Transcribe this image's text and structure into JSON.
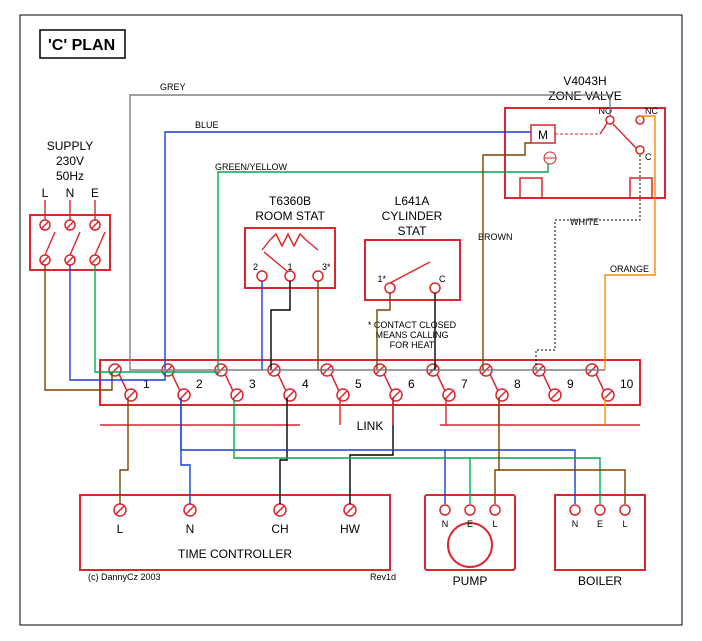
{
  "title": "'C' PLAN",
  "supply": {
    "label": "SUPPLY",
    "voltage": "230V",
    "freq": "50Hz",
    "L": "L",
    "N": "N",
    "E": "E"
  },
  "zone_valve": {
    "model": "V4043H",
    "label": "ZONE VALVE",
    "M": "M",
    "NO": "NO",
    "NC": "NC",
    "C": "C"
  },
  "room_stat": {
    "model": "T6360B",
    "label": "ROOM STAT",
    "t1": "1",
    "t2": "2",
    "t3": "3*"
  },
  "cyl_stat": {
    "model": "L641A",
    "label": "CYLINDER",
    "label2": "STAT",
    "t1": "1*",
    "tC": "C",
    "note1": "* CONTACT CLOSED",
    "note2": "MEANS CALLING",
    "note3": "FOR HEAT"
  },
  "junction": {
    "nums": [
      "1",
      "2",
      "3",
      "4",
      "5",
      "6",
      "7",
      "8",
      "9",
      "10"
    ],
    "link": "LINK"
  },
  "time_controller": {
    "label": "TIME CONTROLLER",
    "L": "L",
    "N": "N",
    "CH": "CH",
    "HW": "HW"
  },
  "pump": {
    "label": "PUMP",
    "N": "N",
    "E": "E",
    "L": "L"
  },
  "boiler": {
    "label": "BOILER",
    "N": "N",
    "E": "E",
    "L": "L"
  },
  "wire_labels": {
    "grey": "GREY",
    "blue": "BLUE",
    "green": "GREEN/YELLOW",
    "brown": "BROWN",
    "white": "WHITE",
    "orange": "ORANGE"
  },
  "footer": {
    "copyright": "(c) DannyCz 2003",
    "rev": "Rev1d"
  }
}
